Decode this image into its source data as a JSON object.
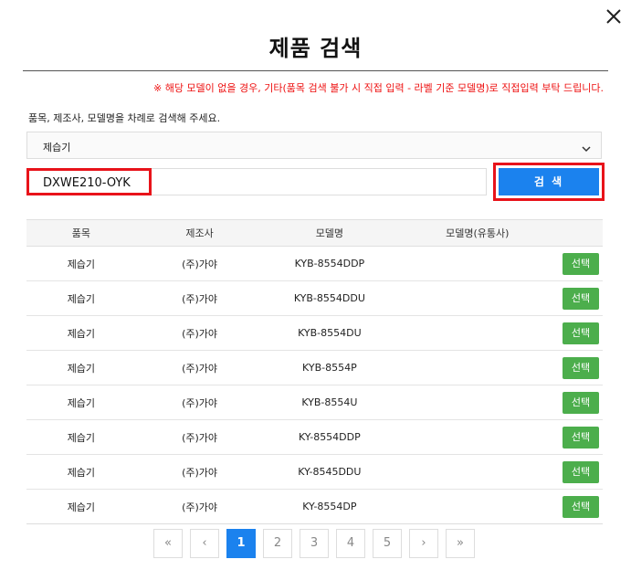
{
  "dialog": {
    "title": "제품 검색",
    "notice": "※ 해당 모델이 없을 경우, 기타(품목 검색 불가 시 직접 입력 - 라벨 기준 모델명)로 직접입력 부탁 드립니다.",
    "guide": "품목, 제조사, 모델명을 차례로 검색해 주세요."
  },
  "filter": {
    "category_value": "제습기",
    "search_value": "DXWE210-OYK",
    "search_button": "검 색"
  },
  "table": {
    "headers": [
      "품목",
      "제조사",
      "모델명",
      "모델명(유통사)",
      ""
    ],
    "rows": [
      {
        "item": "제습기",
        "maker": "(주)가야",
        "model": "KYB-8554DDP",
        "dist_model": "",
        "action": "선택"
      },
      {
        "item": "제습기",
        "maker": "(주)가야",
        "model": "KYB-8554DDU",
        "dist_model": "",
        "action": "선택"
      },
      {
        "item": "제습기",
        "maker": "(주)가야",
        "model": "KYB-8554DU",
        "dist_model": "",
        "action": "선택"
      },
      {
        "item": "제습기",
        "maker": "(주)가야",
        "model": "KYB-8554P",
        "dist_model": "",
        "action": "선택"
      },
      {
        "item": "제습기",
        "maker": "(주)가야",
        "model": "KYB-8554U",
        "dist_model": "",
        "action": "선택"
      },
      {
        "item": "제습기",
        "maker": "(주)가야",
        "model": "KY-8554DDP",
        "dist_model": "",
        "action": "선택"
      },
      {
        "item": "제습기",
        "maker": "(주)가야",
        "model": "KY-8545DDU",
        "dist_model": "",
        "action": "선택"
      },
      {
        "item": "제습기",
        "maker": "(주)가야",
        "model": "KY-8554DP",
        "dist_model": "",
        "action": "선택"
      }
    ]
  },
  "pagination": {
    "first": "«",
    "prev": "‹",
    "pages": [
      "1",
      "2",
      "3",
      "4",
      "5"
    ],
    "current": "1",
    "next": "›",
    "last": "»"
  },
  "colors": {
    "accent": "#1b82ee",
    "highlight": "#e8131a",
    "select_button": "#4cae4c",
    "notice": "#e11111"
  }
}
